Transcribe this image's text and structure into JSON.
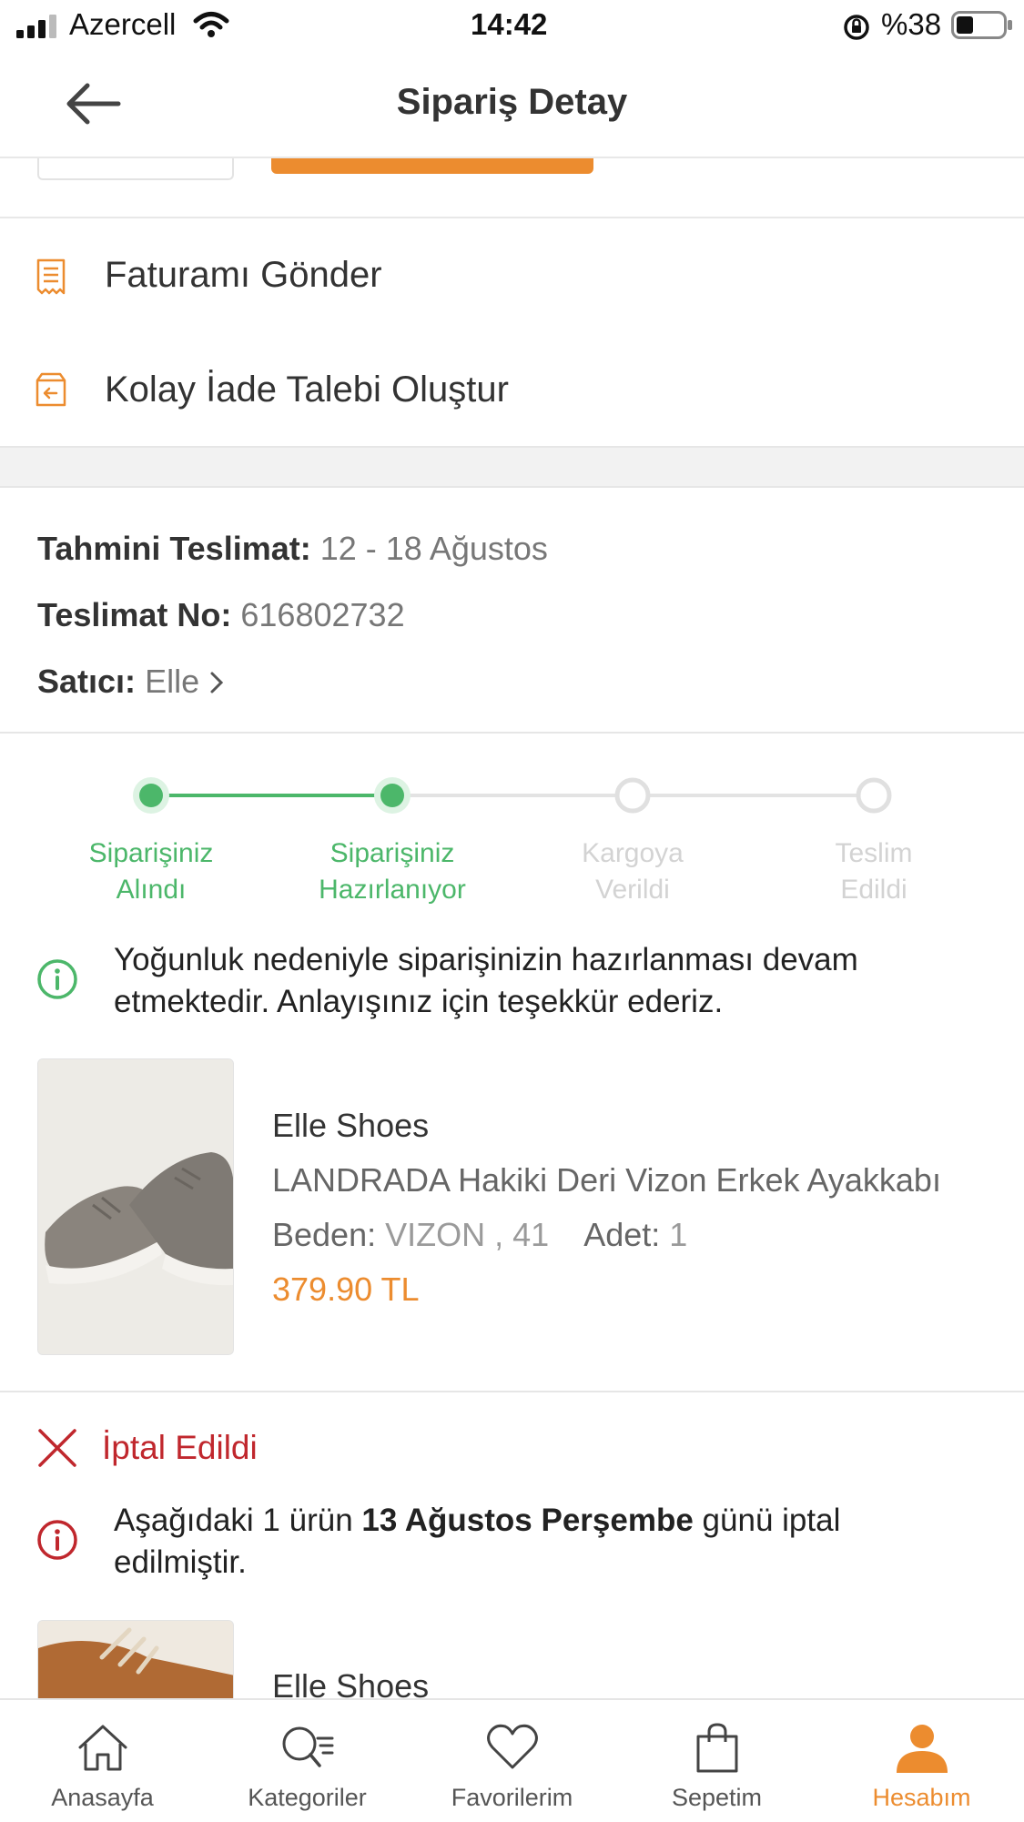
{
  "status_bar": {
    "carrier": "Azercell",
    "time": "14:42",
    "battery": "%38"
  },
  "header": {
    "title": "Sipariş Detay"
  },
  "actions": [
    {
      "label": "Faturamı Gönder",
      "icon": "receipt-icon"
    },
    {
      "label": "Kolay İade Talebi Oluştur",
      "icon": "return-box-icon"
    }
  ],
  "delivery": {
    "estimated_label": "Tahmini Teslimat:",
    "estimated_value": "12 - 18 Ağustos",
    "number_label": "Teslimat No:",
    "number_value": "616802732",
    "seller_label": "Satıcı:",
    "seller_value": "Elle"
  },
  "tracker": {
    "steps": [
      {
        "line1": "Siparişiniz",
        "line2": "Alındı",
        "done": true
      },
      {
        "line1": "Siparişiniz",
        "line2": "Hazırlanıyor",
        "done": true
      },
      {
        "line1": "Kargoya",
        "line2": "Verildi",
        "done": false
      },
      {
        "line1": "Teslim",
        "line2": "Edildi",
        "done": false
      }
    ],
    "notice": "Yoğunluk nedeniyle siparişinizin hazırlanması devam etmektedir. Anlayışınız için teşekkür ederiz."
  },
  "product": {
    "brand": "Elle Shoes",
    "name": "LANDRADA Hakiki Deri Vizon Erkek Ayakkabı",
    "size_label": "Beden:",
    "size_value": "VIZON , 41",
    "qty_label": "Adet:",
    "qty_value": "1",
    "price": "379.90 TL"
  },
  "cancelled": {
    "title": "İptal Edildi",
    "notice_pre": "Aşağıdaki 1 ürün ",
    "notice_bold": "13 Ağustos Perşembe",
    "notice_post": " günü iptal edilmiştir.",
    "product_brand": "Elle Shoes"
  },
  "tabs": [
    {
      "label": "Anasayfa",
      "icon": "home-icon"
    },
    {
      "label": "Kategoriler",
      "icon": "category-search-icon"
    },
    {
      "label": "Favorilerim",
      "icon": "heart-icon"
    },
    {
      "label": "Sepetim",
      "icon": "shopping-bag-icon"
    },
    {
      "label": "Hesabım",
      "icon": "user-icon",
      "active": true
    }
  ],
  "colors": {
    "accent": "#ec8c2f",
    "success": "#4cb76a",
    "danger": "#c0272d",
    "inactive": "#d3d3d3"
  }
}
